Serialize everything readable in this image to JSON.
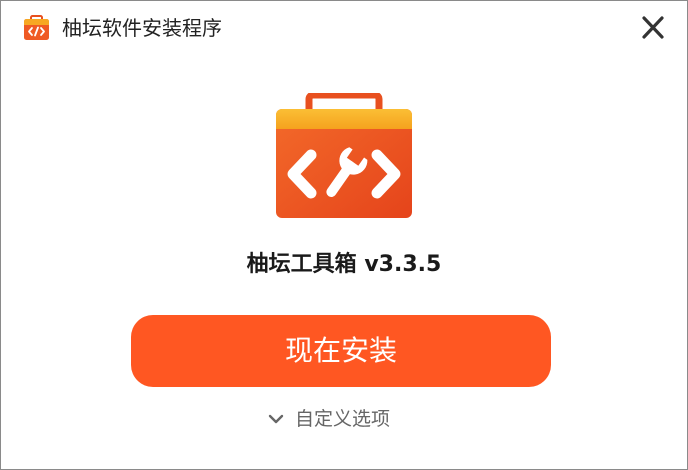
{
  "window": {
    "title": "柚坛软件安装程序"
  },
  "product": {
    "name": "柚坛工具箱 v3.3.5"
  },
  "actions": {
    "install_label": "现在安装",
    "custom_label": "自定义选项"
  },
  "icons": {
    "app": "toolbox-code-icon",
    "close": "close-icon",
    "expand": "chevron-down-icon"
  },
  "colors": {
    "accent": "#ff5722",
    "toolbox_body": "#ef5a24",
    "toolbox_lid": "#f7a823",
    "text_muted": "#666666"
  }
}
